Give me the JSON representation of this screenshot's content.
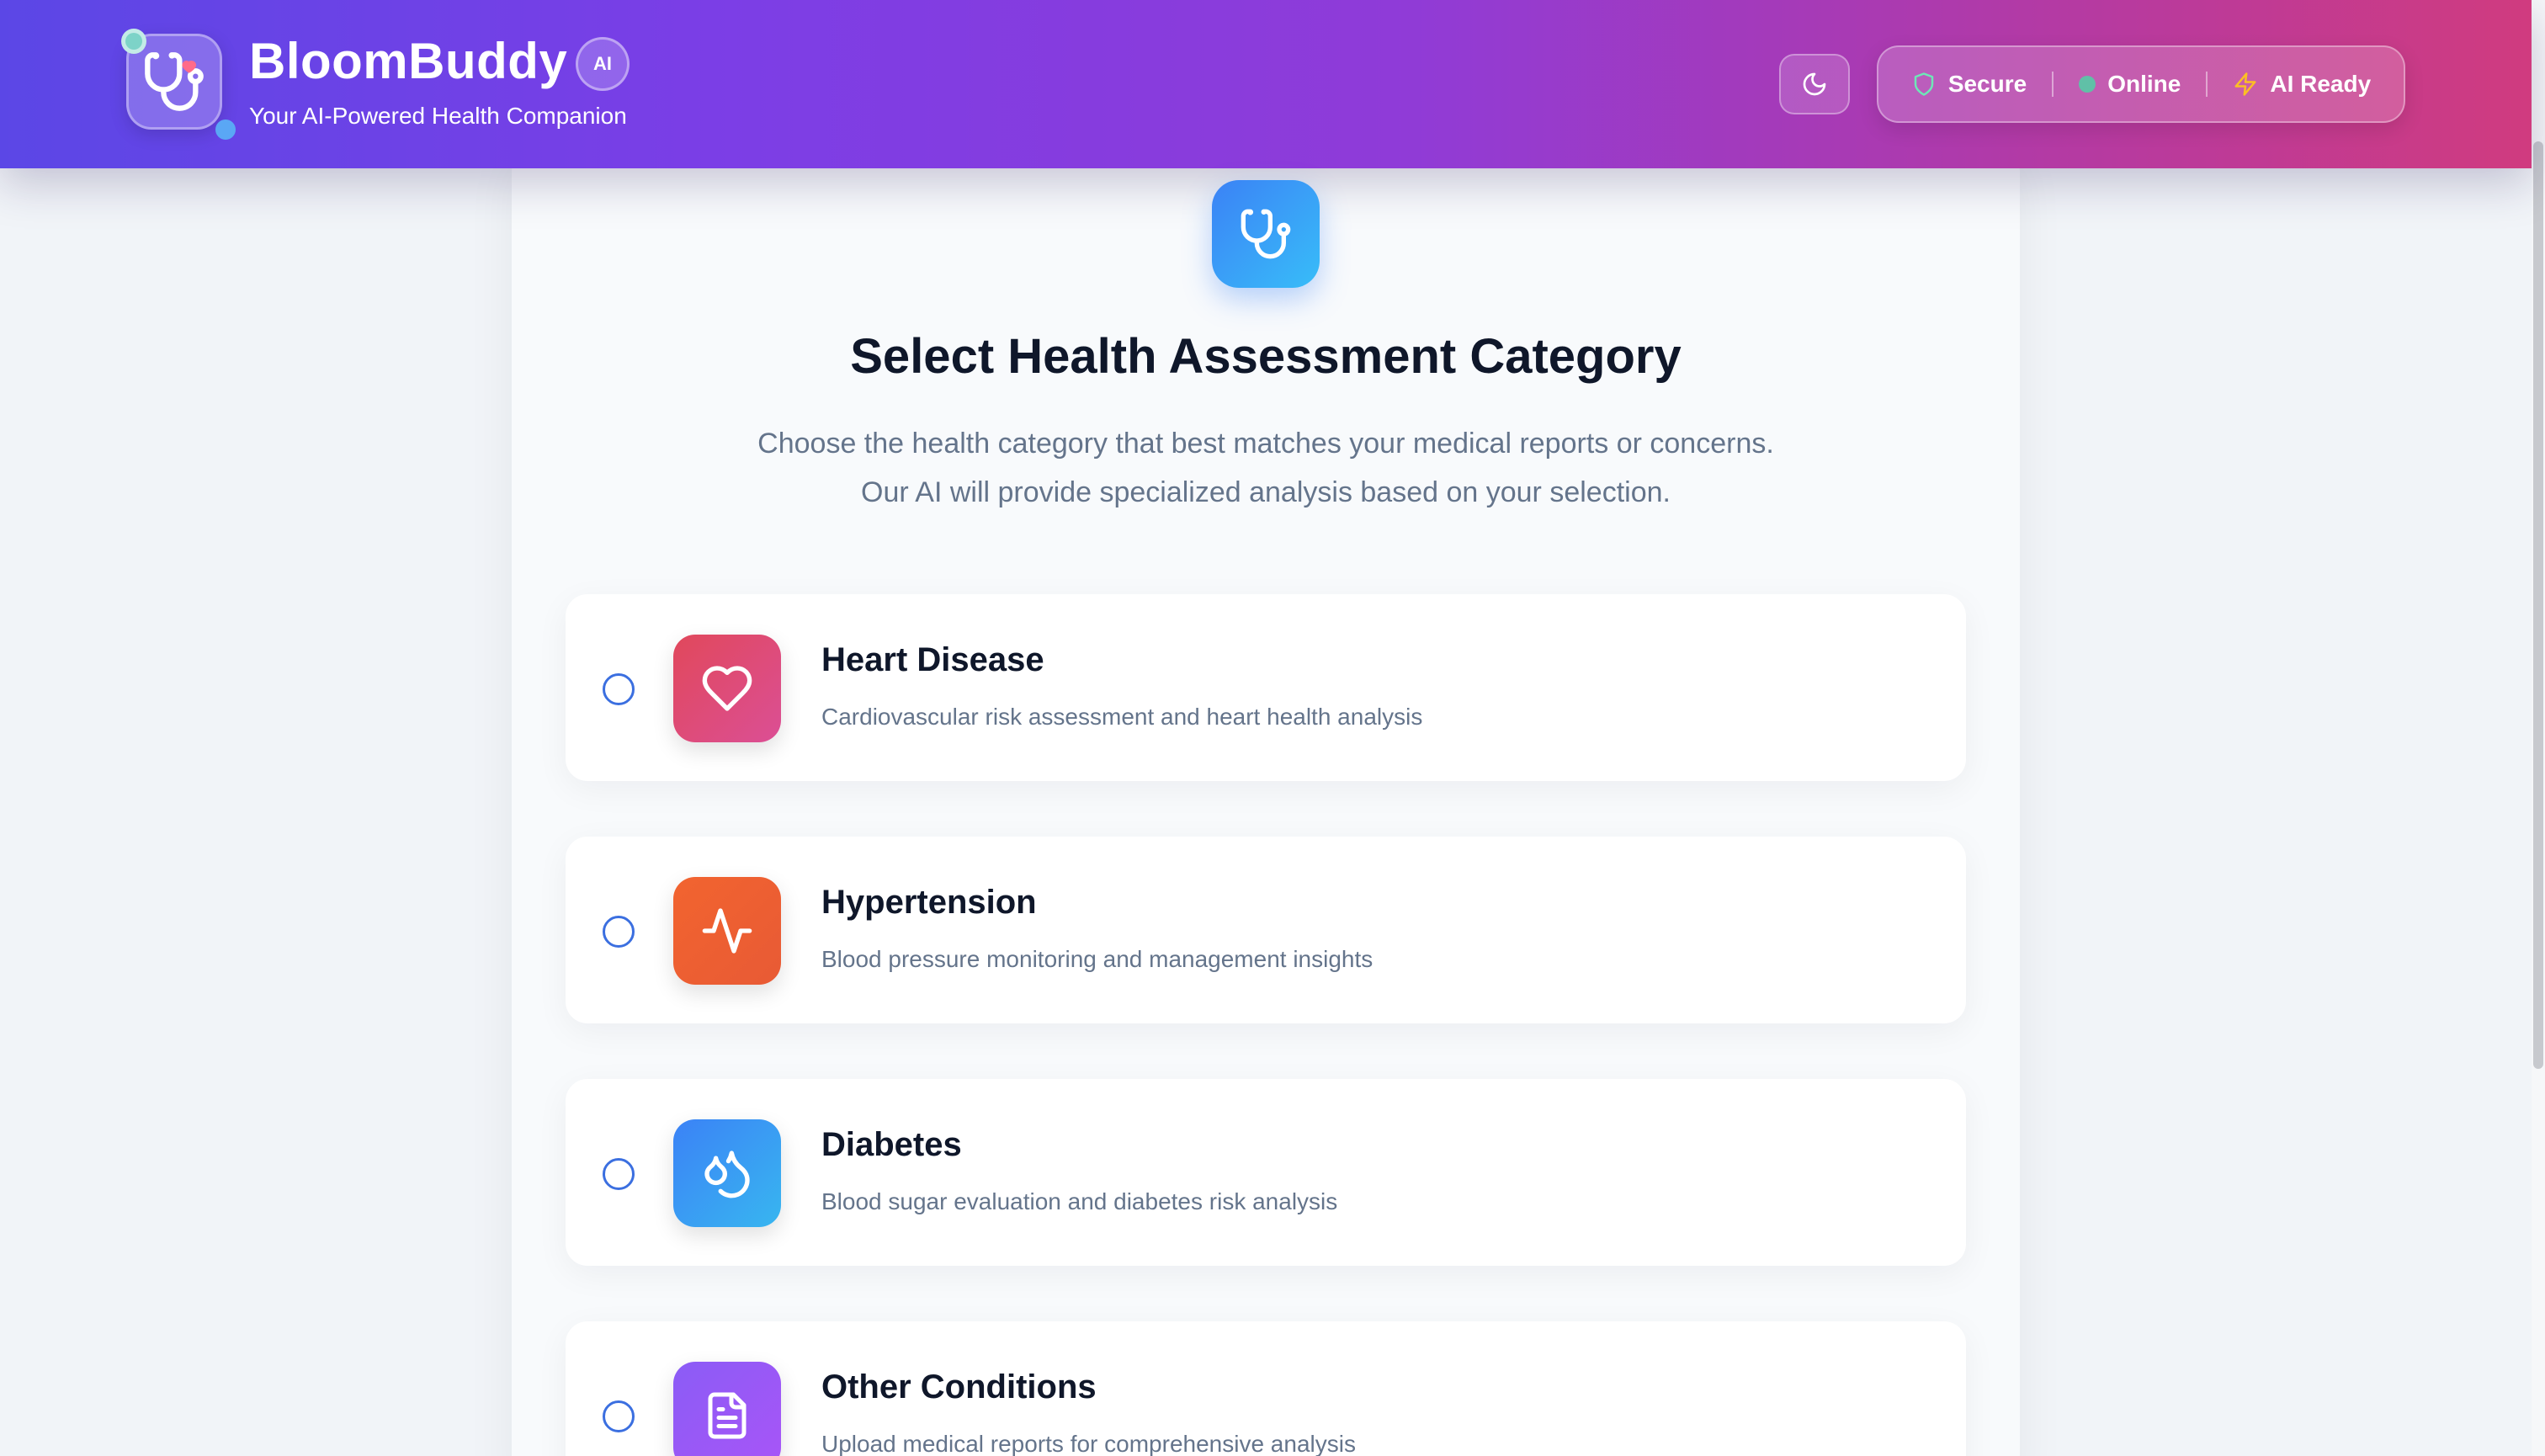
{
  "header": {
    "brand": "BloomBuddy",
    "badge": "AI",
    "tagline": "Your AI-Powered Health Companion",
    "status": [
      {
        "icon": "shield-icon",
        "label": "Secure"
      },
      {
        "icon": "online-dot-icon",
        "label": "Online"
      },
      {
        "icon": "bolt-icon",
        "label": "AI Ready"
      }
    ]
  },
  "main": {
    "title": "Select Health Assessment Category",
    "description_line1": "Choose the health category that best matches your medical reports or concerns.",
    "description_line2": "Our AI will provide specialized analysis based on your selection.",
    "options": [
      {
        "title": "Heart Disease",
        "description": "Cardiovascular risk assessment and heart health analysis",
        "icon": "heart-icon"
      },
      {
        "title": "Hypertension",
        "description": "Blood pressure monitoring and management insights",
        "icon": "pulse-icon"
      },
      {
        "title": "Diabetes",
        "description": "Blood sugar evaluation and diabetes risk analysis",
        "icon": "droplets-icon"
      },
      {
        "title": "Other Conditions",
        "description": "Upload medical reports for comprehensive analysis",
        "icon": "document-icon"
      }
    ]
  },
  "colors": {
    "header_gradient_start": "#5b47e6",
    "header_gradient_end": "#d03b7f",
    "heart_gradient": [
      "#e1485b",
      "#db4f95"
    ],
    "hypertension_gradient": [
      "#f2642f",
      "#e85a35"
    ],
    "diabetes_gradient": [
      "#3b82f6",
      "#38b6f0"
    ],
    "other_gradient": [
      "#8b5cf6",
      "#a855f7"
    ],
    "radio_border": "#3b6fe0"
  }
}
